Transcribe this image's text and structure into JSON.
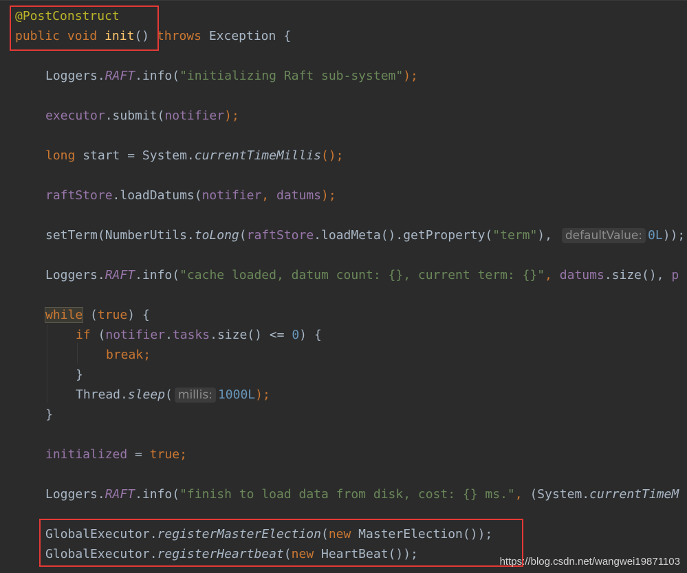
{
  "code": {
    "lines": [
      {
        "tokens": [
          {
            "t": "@PostConstruct",
            "c": "anno"
          }
        ]
      },
      {
        "tokens": [
          {
            "t": "public",
            "c": "kw"
          },
          {
            "t": " ",
            "c": "plain"
          },
          {
            "t": "void",
            "c": "kw"
          },
          {
            "t": " ",
            "c": "plain"
          },
          {
            "t": "init",
            "c": "fn"
          },
          {
            "t": "() ",
            "c": "plain"
          },
          {
            "t": "throws",
            "c": "kw"
          },
          {
            "t": " Exception {",
            "c": "plain"
          }
        ]
      },
      {
        "tokens": [
          {
            "t": "Loggers.",
            "c": "plain"
          },
          {
            "t": "RAFT",
            "c": "sfld"
          },
          {
            "t": ".info(",
            "c": "plain"
          },
          {
            "t": "\"initializing Raft sub-system\"",
            "c": "str"
          },
          {
            "t": ");",
            "c": "kw"
          }
        ]
      },
      {
        "tokens": [
          {
            "t": "executor",
            "c": "fld"
          },
          {
            "t": ".submit(",
            "c": "plain"
          },
          {
            "t": "notifier",
            "c": "fld"
          },
          {
            "t": ");",
            "c": "kw"
          }
        ]
      },
      {
        "tokens": [
          {
            "t": "long",
            "c": "kw"
          },
          {
            "t": " start = System.",
            "c": "plain"
          },
          {
            "t": "currentTimeMillis",
            "c": "ital"
          },
          {
            "t": "();",
            "c": "kw"
          }
        ]
      },
      {
        "tokens": [
          {
            "t": "raftStore",
            "c": "fld"
          },
          {
            "t": ".loadDatums(",
            "c": "plain"
          },
          {
            "t": "notifier",
            "c": "fld"
          },
          {
            "t": ", ",
            "c": "kw"
          },
          {
            "t": "datums",
            "c": "fld"
          },
          {
            "t": ");",
            "c": "kw"
          }
        ]
      },
      {
        "tokens": [
          {
            "t": "setTerm(NumberUtils.",
            "c": "plain"
          },
          {
            "t": "toLong",
            "c": "ital"
          },
          {
            "t": "(",
            "c": "plain"
          },
          {
            "t": "raftStore",
            "c": "fld"
          },
          {
            "t": ".loadMeta().getProperty(",
            "c": "plain"
          },
          {
            "t": "\"term\"",
            "c": "str"
          },
          {
            "t": "), ",
            "c": "plain"
          },
          {
            "t": "defaultValue:",
            "c": "hint"
          },
          {
            "t": "0L",
            "c": "num"
          },
          {
            "t": "));",
            "c": "plain"
          }
        ]
      },
      {
        "tokens": [
          {
            "t": "Loggers.",
            "c": "plain"
          },
          {
            "t": "RAFT",
            "c": "sfld"
          },
          {
            "t": ".info(",
            "c": "plain"
          },
          {
            "t": "\"cache loaded, datum count: {}, current term: {}\"",
            "c": "str"
          },
          {
            "t": ", ",
            "c": "kw"
          },
          {
            "t": "datums",
            "c": "fld"
          },
          {
            "t": ".size(), ",
            "c": "plain"
          },
          {
            "t": "p",
            "c": "fld"
          }
        ]
      },
      {
        "tokens": [
          {
            "t": "while",
            "c": "kw hl-while"
          },
          {
            "t": " (",
            "c": "plain"
          },
          {
            "t": "true",
            "c": "kw"
          },
          {
            "t": ") {",
            "c": "plain"
          }
        ]
      },
      {
        "tokens": [
          {
            "t": "if",
            "c": "kw"
          },
          {
            "t": " (",
            "c": "plain"
          },
          {
            "t": "notifier",
            "c": "fld"
          },
          {
            "t": ".",
            "c": "plain"
          },
          {
            "t": "tasks",
            "c": "fld"
          },
          {
            "t": ".size() <= ",
            "c": "plain"
          },
          {
            "t": "0",
            "c": "num"
          },
          {
            "t": ") {",
            "c": "plain"
          }
        ]
      },
      {
        "tokens": [
          {
            "t": "break",
            "c": "kw"
          },
          {
            "t": ";",
            "c": "kw"
          }
        ]
      },
      {
        "tokens": [
          {
            "t": "}",
            "c": "plain"
          }
        ]
      },
      {
        "tokens": [
          {
            "t": "Thread.",
            "c": "plain"
          },
          {
            "t": "sleep",
            "c": "ital"
          },
          {
            "t": "(",
            "c": "plain"
          },
          {
            "t": "millis:",
            "c": "hint"
          },
          {
            "t": "1000L",
            "c": "num"
          },
          {
            "t": ");",
            "c": "kw"
          }
        ]
      },
      {
        "tokens": [
          {
            "t": "}",
            "c": "plain"
          }
        ]
      },
      {
        "tokens": [
          {
            "t": "initialized",
            "c": "fld"
          },
          {
            "t": " = ",
            "c": "plain"
          },
          {
            "t": "true",
            "c": "kw"
          },
          {
            "t": ";",
            "c": "kw"
          }
        ]
      },
      {
        "tokens": [
          {
            "t": "Loggers.",
            "c": "plain"
          },
          {
            "t": "RAFT",
            "c": "sfld"
          },
          {
            "t": ".info(",
            "c": "plain"
          },
          {
            "t": "\"finish to load data from disk, cost: {} ms.\"",
            "c": "str"
          },
          {
            "t": ", ",
            "c": "kw"
          },
          {
            "t": "(System.",
            "c": "plain"
          },
          {
            "t": "currentTimeM",
            "c": "ital"
          }
        ]
      },
      {
        "tokens": [
          {
            "t": "GlobalExecutor.",
            "c": "plain"
          },
          {
            "t": "registerMasterElection",
            "c": "ital"
          },
          {
            "t": "(",
            "c": "plain"
          },
          {
            "t": "new",
            "c": "kw"
          },
          {
            "t": " MasterElection());",
            "c": "plain"
          }
        ]
      },
      {
        "tokens": [
          {
            "t": "GlobalExecutor.",
            "c": "plain"
          },
          {
            "t": "registerHeartbeat",
            "c": "ital"
          },
          {
            "t": "(",
            "c": "plain"
          },
          {
            "t": "new",
            "c": "kw"
          },
          {
            "t": " HeartBeat());",
            "c": "plain"
          }
        ]
      }
    ]
  },
  "watermark": "https://blog.csdn.net/wangwei19871103",
  "colors": {
    "background": "#2b2b2b",
    "keyword": "#cc7832",
    "annotation": "#bbb529",
    "method_decl": "#ffc66d",
    "string": "#6a8759",
    "number": "#6897bb",
    "field": "#9876aa",
    "text": "#a9b7c6",
    "highlight_box": "#e53935"
  }
}
